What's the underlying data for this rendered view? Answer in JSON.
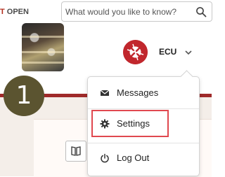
{
  "header": {
    "top_link_prefix": "T",
    "top_link_rest": " OPEN",
    "search": {
      "placeholder": "What would you like to know?"
    }
  },
  "user": {
    "name": "ECU"
  },
  "step": {
    "number": "1"
  },
  "dropdown": {
    "items": [
      {
        "label": "Messages",
        "icon": "envelope-icon"
      },
      {
        "label": "Settings",
        "icon": "gear-icon"
      },
      {
        "label": "Log Out",
        "icon": "power-icon"
      }
    ],
    "highlighted": "Settings"
  },
  "colors": {
    "brand_red": "#c1272d",
    "bar_red": "#9f2a2a",
    "highlight": "#e0484f",
    "step_circle": "#5b5430"
  }
}
